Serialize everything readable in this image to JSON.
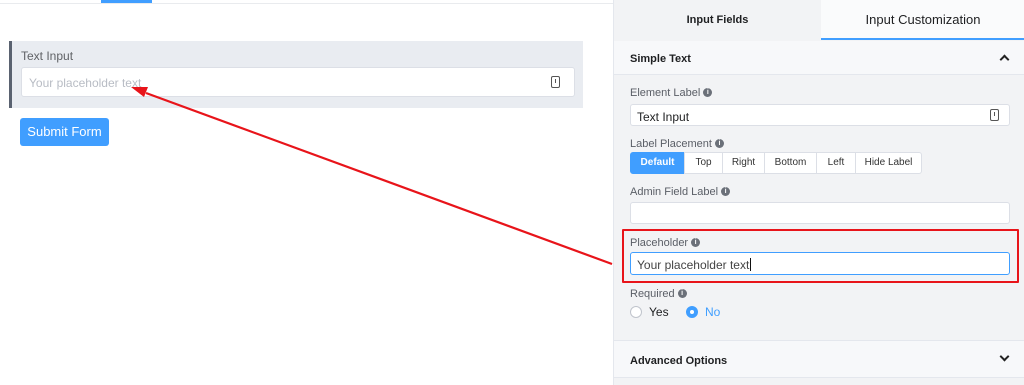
{
  "preview": {
    "field_label": "Text Input",
    "placeholder": "Your placeholder text",
    "submit_label": "Submit Form"
  },
  "tabs": {
    "input_fields": "Input Fields",
    "input_customization": "Input Customization"
  },
  "section": {
    "title": "Simple Text"
  },
  "settings": {
    "element_label": {
      "label": "Element Label",
      "value": "Text Input"
    },
    "label_placement": {
      "label": "Label Placement",
      "options": [
        "Default",
        "Top",
        "Right",
        "Bottom",
        "Left",
        "Hide Label"
      ],
      "selected": "Default"
    },
    "admin_field_label": {
      "label": "Admin Field Label",
      "value": ""
    },
    "placeholder": {
      "label": "Placeholder",
      "value": "Your placeholder text"
    },
    "required": {
      "label": "Required",
      "yes": "Yes",
      "no": "No",
      "selected": "No"
    }
  },
  "advanced": {
    "title": "Advanced Options"
  },
  "colors": {
    "accent": "#409eff",
    "annotation_red": "#e8141a"
  },
  "icons": [
    "info-icon",
    "field-options-icon",
    "chevron-up-icon",
    "chevron-down-icon"
  ]
}
